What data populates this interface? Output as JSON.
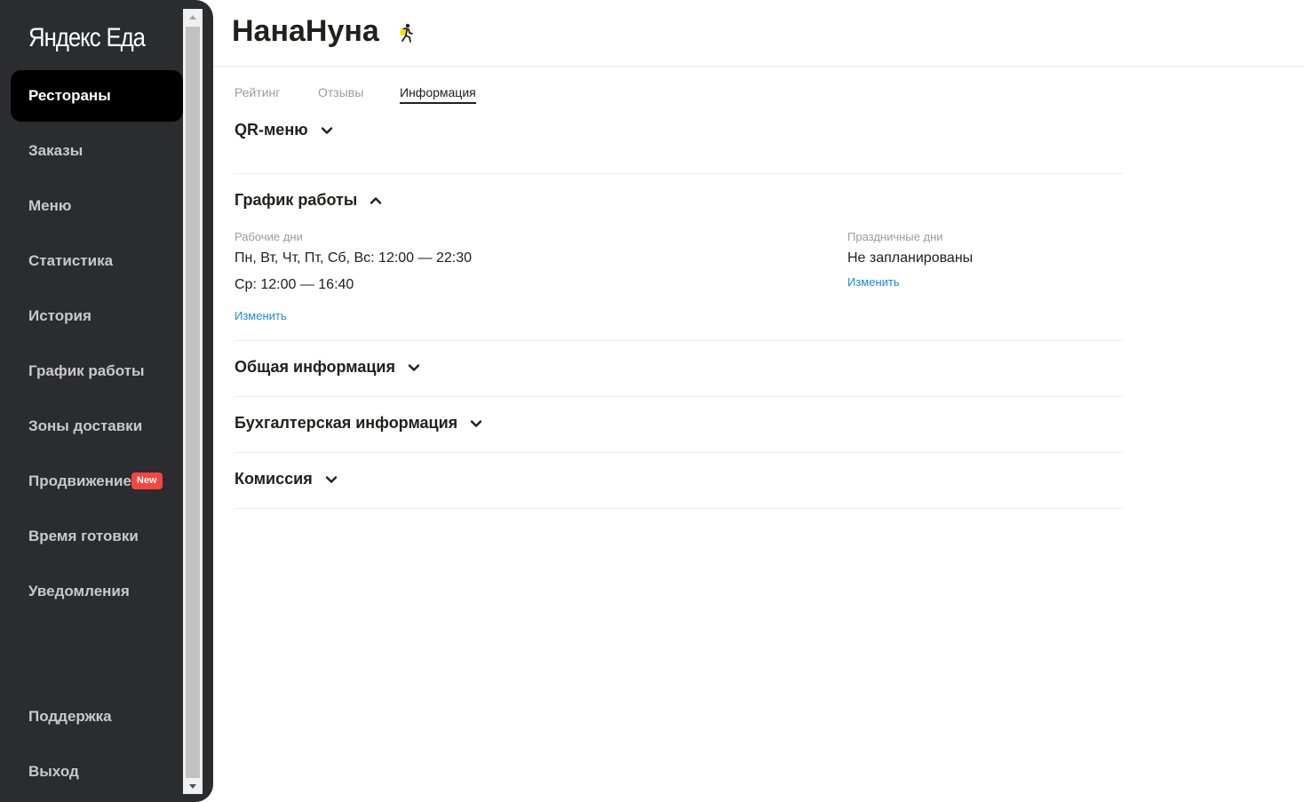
{
  "sidebar": {
    "logo_part1": "Яндекс",
    "logo_part2": "Еда",
    "items": [
      {
        "label": "Рестораны",
        "active": true
      },
      {
        "label": "Заказы"
      },
      {
        "label": "Меню"
      },
      {
        "label": "Статистика"
      },
      {
        "label": "История"
      },
      {
        "label": "График работы"
      },
      {
        "label": "Зоны доставки"
      },
      {
        "label": "Продвижение",
        "badge": "New"
      },
      {
        "label": "Время готовки"
      },
      {
        "label": "Уведомления"
      }
    ],
    "bottom_items": [
      {
        "label": "Поддержка"
      },
      {
        "label": "Выход"
      }
    ]
  },
  "header": {
    "title": "НанаНуна",
    "icon": "runner-icon"
  },
  "tabs": [
    {
      "label": "Рейтинг"
    },
    {
      "label": "Отзывы"
    },
    {
      "label": "Информация",
      "active": true
    }
  ],
  "sections": {
    "qr_menu": {
      "title": "QR-меню",
      "expanded": false
    },
    "schedule": {
      "title": "График работы",
      "expanded": true,
      "working_days": {
        "label": "Рабочие дни",
        "lines": [
          "Пн, Вт, Чт, Пт, Сб, Вс: 12:00 — 22:30",
          "Ср: 12:00 — 16:40"
        ],
        "edit_link": "Изменить"
      },
      "holidays": {
        "label": "Праздничные дни",
        "value": "Не запланированы",
        "edit_link": "Изменить"
      }
    },
    "general_info": {
      "title": "Общая информация",
      "expanded": false
    },
    "accounting_info": {
      "title": "Бухгалтерская информация",
      "expanded": false
    },
    "commission": {
      "title": "Комиссия",
      "expanded": false
    }
  },
  "colors": {
    "sidebar_bg": "#2b2c30",
    "active_item_bg": "#000000",
    "badge_bg": "#f5453f",
    "link": "#1a8bde"
  }
}
